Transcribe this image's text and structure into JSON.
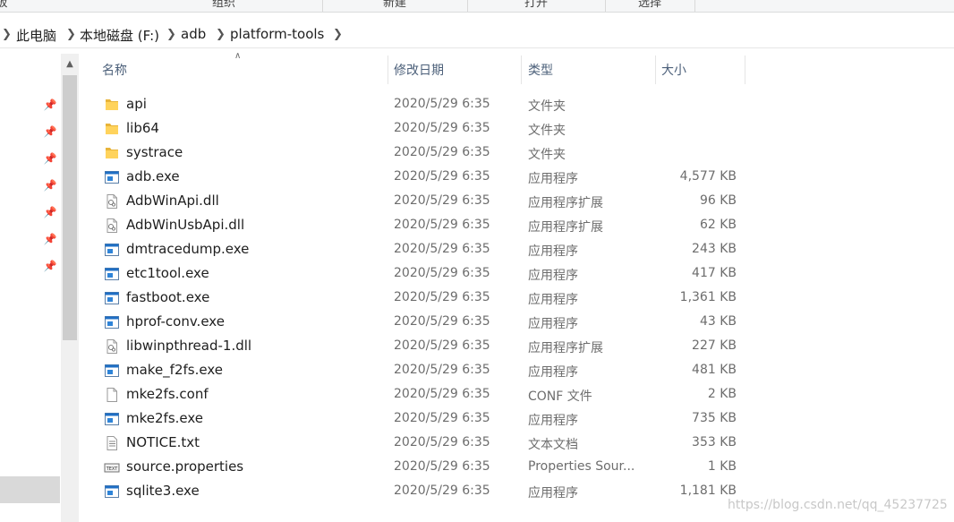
{
  "ribbon": {
    "groups": [
      "板",
      "组织",
      "新建",
      "打开",
      "选择"
    ]
  },
  "breadcrumb": [
    "此电脑",
    "本地磁盘 (F:)",
    "adb",
    "platform-tools"
  ],
  "columns": {
    "name": "名称",
    "date": "修改日期",
    "type": "类型",
    "size": "大小"
  },
  "files": [
    {
      "name": "api",
      "date": "2020/5/29 6:35",
      "type": "文件夹",
      "size": "",
      "icon": "folder-icon"
    },
    {
      "name": "lib64",
      "date": "2020/5/29 6:35",
      "type": "文件夹",
      "size": "",
      "icon": "folder-icon"
    },
    {
      "name": "systrace",
      "date": "2020/5/29 6:35",
      "type": "文件夹",
      "size": "",
      "icon": "folder-icon"
    },
    {
      "name": "adb.exe",
      "date": "2020/5/29 6:35",
      "type": "应用程序",
      "size": "4,577 KB",
      "icon": "exe-icon"
    },
    {
      "name": "AdbWinApi.dll",
      "date": "2020/5/29 6:35",
      "type": "应用程序扩展",
      "size": "96 KB",
      "icon": "dll-icon"
    },
    {
      "name": "AdbWinUsbApi.dll",
      "date": "2020/5/29 6:35",
      "type": "应用程序扩展",
      "size": "62 KB",
      "icon": "dll-icon"
    },
    {
      "name": "dmtracedump.exe",
      "date": "2020/5/29 6:35",
      "type": "应用程序",
      "size": "243 KB",
      "icon": "exe-icon"
    },
    {
      "name": "etc1tool.exe",
      "date": "2020/5/29 6:35",
      "type": "应用程序",
      "size": "417 KB",
      "icon": "exe-icon"
    },
    {
      "name": "fastboot.exe",
      "date": "2020/5/29 6:35",
      "type": "应用程序",
      "size": "1,361 KB",
      "icon": "exe-icon"
    },
    {
      "name": "hprof-conv.exe",
      "date": "2020/5/29 6:35",
      "type": "应用程序",
      "size": "43 KB",
      "icon": "exe-icon"
    },
    {
      "name": "libwinpthread-1.dll",
      "date": "2020/5/29 6:35",
      "type": "应用程序扩展",
      "size": "227 KB",
      "icon": "dll-icon"
    },
    {
      "name": "make_f2fs.exe",
      "date": "2020/5/29 6:35",
      "type": "应用程序",
      "size": "481 KB",
      "icon": "exe-icon"
    },
    {
      "name": "mke2fs.conf",
      "date": "2020/5/29 6:35",
      "type": "CONF 文件",
      "size": "2 KB",
      "icon": "file-icon"
    },
    {
      "name": "mke2fs.exe",
      "date": "2020/5/29 6:35",
      "type": "应用程序",
      "size": "735 KB",
      "icon": "exe-icon"
    },
    {
      "name": "NOTICE.txt",
      "date": "2020/5/29 6:35",
      "type": "文本文档",
      "size": "353 KB",
      "icon": "txt-icon"
    },
    {
      "name": "source.properties",
      "date": "2020/5/29 6:35",
      "type": "Properties Sour...",
      "size": "1 KB",
      "icon": "properties-icon"
    },
    {
      "name": "sqlite3.exe",
      "date": "2020/5/29 6:35",
      "type": "应用程序",
      "size": "1,181 KB",
      "icon": "exe-icon"
    }
  ],
  "watermark": "https://blog.csdn.net/qq_45237725",
  "colors": {
    "folder": "#ffd35c",
    "exe_accent": "#1f6fc5",
    "header_text": "#4c607a"
  }
}
